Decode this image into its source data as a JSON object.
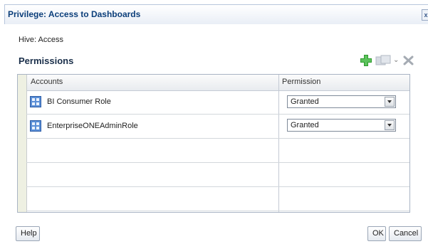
{
  "dialog": {
    "title": "Privilege: Access to Dashboards",
    "hive": "Hive: Access",
    "section_title": "Permissions"
  },
  "toolbar": {
    "icons": [
      "add-icon",
      "duplicate-icon",
      "chevron-down-icon",
      "delete-icon"
    ]
  },
  "table": {
    "columns": [
      "Accounts",
      "Permission"
    ],
    "rows": [
      {
        "account": "BI Consumer Role",
        "permission": "Granted"
      },
      {
        "account": "EnterpriseONEAdminRole",
        "permission": "Granted"
      }
    ],
    "empty_rows": 4
  },
  "footer": {
    "help_label": "Help",
    "ok_label": "OK",
    "cancel_label": "Cancel"
  },
  "colors": {
    "title_text": "#0b3e7a",
    "add_icon": "#2e9a2e",
    "role_icon": "#3b6fc4"
  }
}
